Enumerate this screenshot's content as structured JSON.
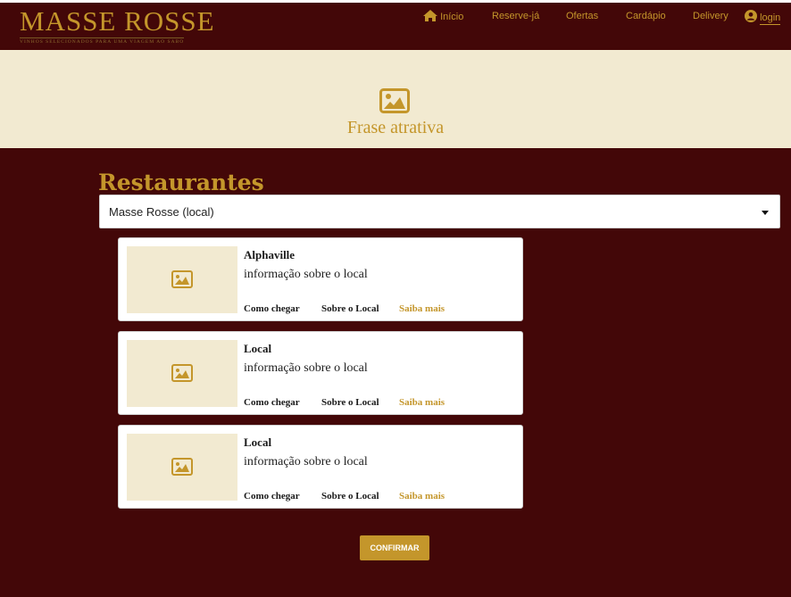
{
  "brand": {
    "name": "MASSE ROSSE",
    "tagline": "VINHOS SELECIONADOS PARA UMA VIAGEM AO SABOR",
    "accent_color": "#c4962b",
    "dark_color": "#430708",
    "cream_color": "#f2ead1"
  },
  "nav": {
    "items": [
      {
        "label": "Início",
        "icon": "home-icon"
      },
      {
        "label": "Reserve-já"
      },
      {
        "label": "Ofertas"
      },
      {
        "label": "Cardápio"
      },
      {
        "label": "Delivery"
      },
      {
        "label": "login",
        "icon": "user-icon"
      }
    ]
  },
  "hero": {
    "icon": "image-icon",
    "title": "Frase atrativa"
  },
  "restaurants": {
    "title": "Restaurantes",
    "select_value": "Masse Rosse (local)",
    "cards": [
      {
        "name": "Alphaville",
        "info": "informação sobre o local",
        "link_directions": "Como chegar",
        "link_about": "Sobre o Local",
        "link_more": "Saiba mais",
        "image_icon": "image-icon"
      },
      {
        "name": "Local",
        "info": "informação sobre o local",
        "link_directions": "Como chegar",
        "link_about": "Sobre o Local",
        "link_more": "Saiba mais",
        "image_icon": "image-icon"
      },
      {
        "name": "Local",
        "info": "informação sobre o local",
        "link_directions": "Como chegar",
        "link_about": "Sobre o Local",
        "link_more": "Saiba mais",
        "image_icon": "image-icon"
      }
    ]
  },
  "confirm_label": "CONFIRMAR"
}
